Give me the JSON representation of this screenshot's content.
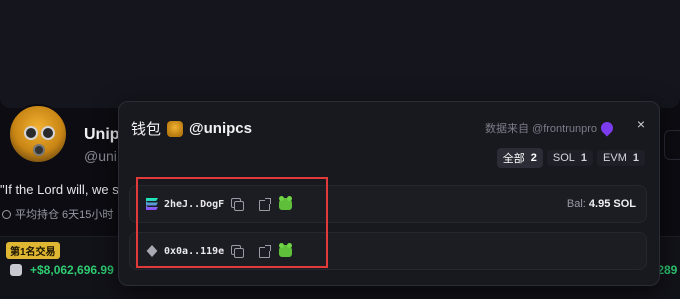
{
  "background": {
    "name": "Unip",
    "handle": "@uni",
    "quote": "\"If the Lord will, we s",
    "hold_time": "平均持仓 6天15小时",
    "rank_badge": "第1名交易",
    "pnl_left": "+$8,062,696.99",
    "pnl_right": ",289"
  },
  "modal": {
    "title_prefix": "钱包",
    "handle": "@unipcs",
    "source": "数据来自 @frontrunpro",
    "close": "×",
    "filters": [
      {
        "label": "全部",
        "count": "2"
      },
      {
        "label": "SOL",
        "count": "1"
      },
      {
        "label": "EVM",
        "count": "1"
      }
    ],
    "wallets": [
      {
        "chain": "solana-icon",
        "address": "2heJ..DogF",
        "balance_label": "Bal:",
        "balance_value": "4.95 SOL"
      },
      {
        "chain": "ethereum-icon",
        "address": "0x0a..119e"
      }
    ]
  },
  "colors": {
    "accent_purple": "#7b3cf0",
    "positive_green": "#2ecb71",
    "highlight_red": "#e03a3a",
    "badge_gold": "#e0b732"
  }
}
